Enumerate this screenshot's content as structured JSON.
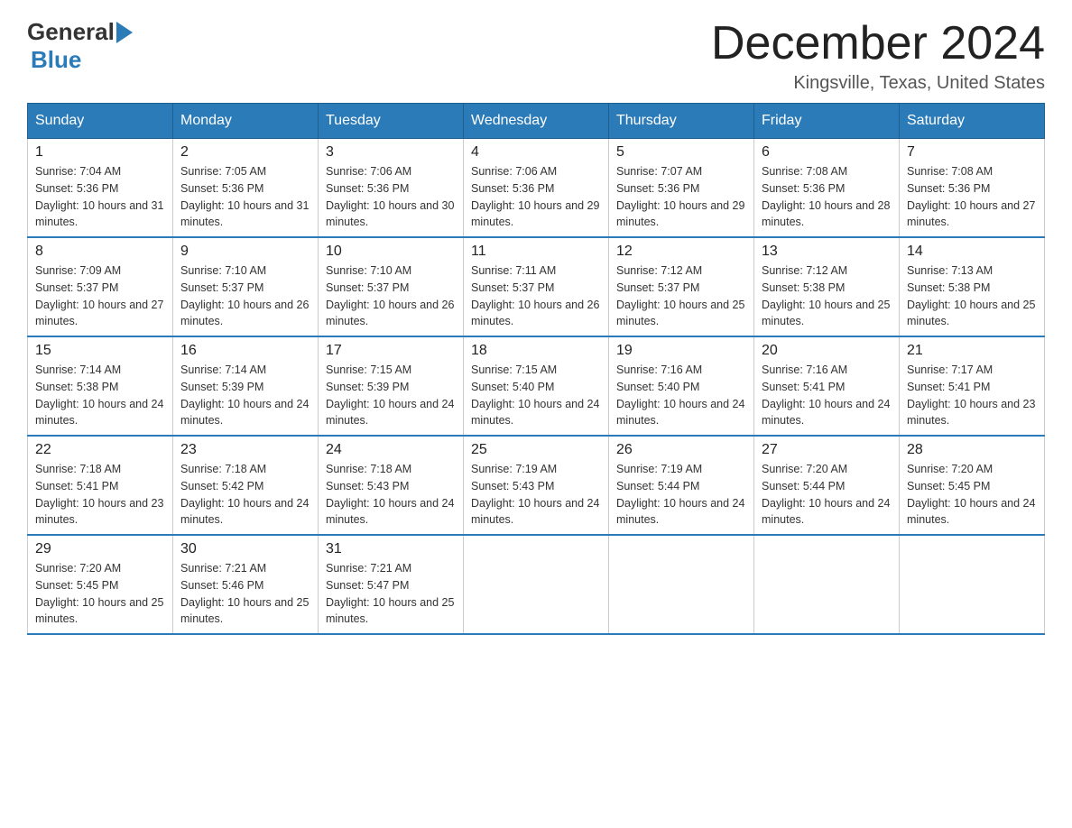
{
  "header": {
    "month_title": "December 2024",
    "location": "Kingsville, Texas, United States",
    "logo_general": "General",
    "logo_blue": "Blue"
  },
  "weekdays": [
    "Sunday",
    "Monday",
    "Tuesday",
    "Wednesday",
    "Thursday",
    "Friday",
    "Saturday"
  ],
  "weeks": [
    [
      {
        "day": "1",
        "sunrise": "7:04 AM",
        "sunset": "5:36 PM",
        "daylight": "10 hours and 31 minutes."
      },
      {
        "day": "2",
        "sunrise": "7:05 AM",
        "sunset": "5:36 PM",
        "daylight": "10 hours and 31 minutes."
      },
      {
        "day": "3",
        "sunrise": "7:06 AM",
        "sunset": "5:36 PM",
        "daylight": "10 hours and 30 minutes."
      },
      {
        "day": "4",
        "sunrise": "7:06 AM",
        "sunset": "5:36 PM",
        "daylight": "10 hours and 29 minutes."
      },
      {
        "day": "5",
        "sunrise": "7:07 AM",
        "sunset": "5:36 PM",
        "daylight": "10 hours and 29 minutes."
      },
      {
        "day": "6",
        "sunrise": "7:08 AM",
        "sunset": "5:36 PM",
        "daylight": "10 hours and 28 minutes."
      },
      {
        "day": "7",
        "sunrise": "7:08 AM",
        "sunset": "5:36 PM",
        "daylight": "10 hours and 27 minutes."
      }
    ],
    [
      {
        "day": "8",
        "sunrise": "7:09 AM",
        "sunset": "5:37 PM",
        "daylight": "10 hours and 27 minutes."
      },
      {
        "day": "9",
        "sunrise": "7:10 AM",
        "sunset": "5:37 PM",
        "daylight": "10 hours and 26 minutes."
      },
      {
        "day": "10",
        "sunrise": "7:10 AM",
        "sunset": "5:37 PM",
        "daylight": "10 hours and 26 minutes."
      },
      {
        "day": "11",
        "sunrise": "7:11 AM",
        "sunset": "5:37 PM",
        "daylight": "10 hours and 26 minutes."
      },
      {
        "day": "12",
        "sunrise": "7:12 AM",
        "sunset": "5:37 PM",
        "daylight": "10 hours and 25 minutes."
      },
      {
        "day": "13",
        "sunrise": "7:12 AM",
        "sunset": "5:38 PM",
        "daylight": "10 hours and 25 minutes."
      },
      {
        "day": "14",
        "sunrise": "7:13 AM",
        "sunset": "5:38 PM",
        "daylight": "10 hours and 25 minutes."
      }
    ],
    [
      {
        "day": "15",
        "sunrise": "7:14 AM",
        "sunset": "5:38 PM",
        "daylight": "10 hours and 24 minutes."
      },
      {
        "day": "16",
        "sunrise": "7:14 AM",
        "sunset": "5:39 PM",
        "daylight": "10 hours and 24 minutes."
      },
      {
        "day": "17",
        "sunrise": "7:15 AM",
        "sunset": "5:39 PM",
        "daylight": "10 hours and 24 minutes."
      },
      {
        "day": "18",
        "sunrise": "7:15 AM",
        "sunset": "5:40 PM",
        "daylight": "10 hours and 24 minutes."
      },
      {
        "day": "19",
        "sunrise": "7:16 AM",
        "sunset": "5:40 PM",
        "daylight": "10 hours and 24 minutes."
      },
      {
        "day": "20",
        "sunrise": "7:16 AM",
        "sunset": "5:41 PM",
        "daylight": "10 hours and 24 minutes."
      },
      {
        "day": "21",
        "sunrise": "7:17 AM",
        "sunset": "5:41 PM",
        "daylight": "10 hours and 23 minutes."
      }
    ],
    [
      {
        "day": "22",
        "sunrise": "7:18 AM",
        "sunset": "5:41 PM",
        "daylight": "10 hours and 23 minutes."
      },
      {
        "day": "23",
        "sunrise": "7:18 AM",
        "sunset": "5:42 PM",
        "daylight": "10 hours and 24 minutes."
      },
      {
        "day": "24",
        "sunrise": "7:18 AM",
        "sunset": "5:43 PM",
        "daylight": "10 hours and 24 minutes."
      },
      {
        "day": "25",
        "sunrise": "7:19 AM",
        "sunset": "5:43 PM",
        "daylight": "10 hours and 24 minutes."
      },
      {
        "day": "26",
        "sunrise": "7:19 AM",
        "sunset": "5:44 PM",
        "daylight": "10 hours and 24 minutes."
      },
      {
        "day": "27",
        "sunrise": "7:20 AM",
        "sunset": "5:44 PM",
        "daylight": "10 hours and 24 minutes."
      },
      {
        "day": "28",
        "sunrise": "7:20 AM",
        "sunset": "5:45 PM",
        "daylight": "10 hours and 24 minutes."
      }
    ],
    [
      {
        "day": "29",
        "sunrise": "7:20 AM",
        "sunset": "5:45 PM",
        "daylight": "10 hours and 25 minutes."
      },
      {
        "day": "30",
        "sunrise": "7:21 AM",
        "sunset": "5:46 PM",
        "daylight": "10 hours and 25 minutes."
      },
      {
        "day": "31",
        "sunrise": "7:21 AM",
        "sunset": "5:47 PM",
        "daylight": "10 hours and 25 minutes."
      },
      null,
      null,
      null,
      null
    ]
  ]
}
